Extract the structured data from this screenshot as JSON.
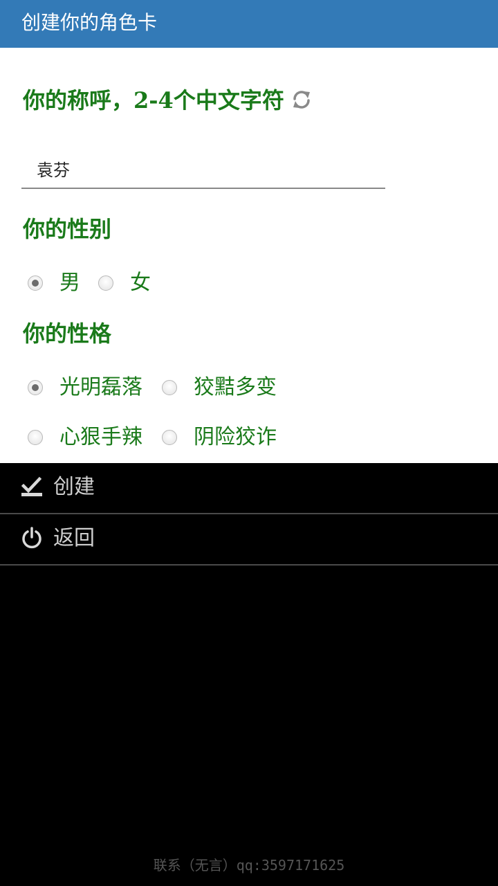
{
  "titlebar": {
    "title": "创建你的角色卡"
  },
  "name_section": {
    "heading": "你的称呼，2-4个中文字符",
    "refresh_icon": "refresh-icon",
    "input_value": "袁芬"
  },
  "gender_section": {
    "heading": "你的性别",
    "options": [
      {
        "label": "男",
        "checked": true
      },
      {
        "label": "女",
        "checked": false
      }
    ]
  },
  "personality_section": {
    "heading": "你的性格",
    "options": [
      {
        "label": "光明磊落",
        "checked": true
      },
      {
        "label": "狡黠多变",
        "checked": false
      },
      {
        "label": "心狠手辣",
        "checked": false
      },
      {
        "label": "阴险狡诈",
        "checked": false
      }
    ]
  },
  "menu": {
    "create_label": "创建",
    "create_icon": "create-check-icon",
    "back_label": "返回",
    "back_icon": "power-icon"
  },
  "footer": {
    "text": "联系（无言）qq:3597171625"
  },
  "colors": {
    "titlebar": "#337ab7",
    "heading_green": "#1a7a1a",
    "menu_bg": "#000000"
  }
}
